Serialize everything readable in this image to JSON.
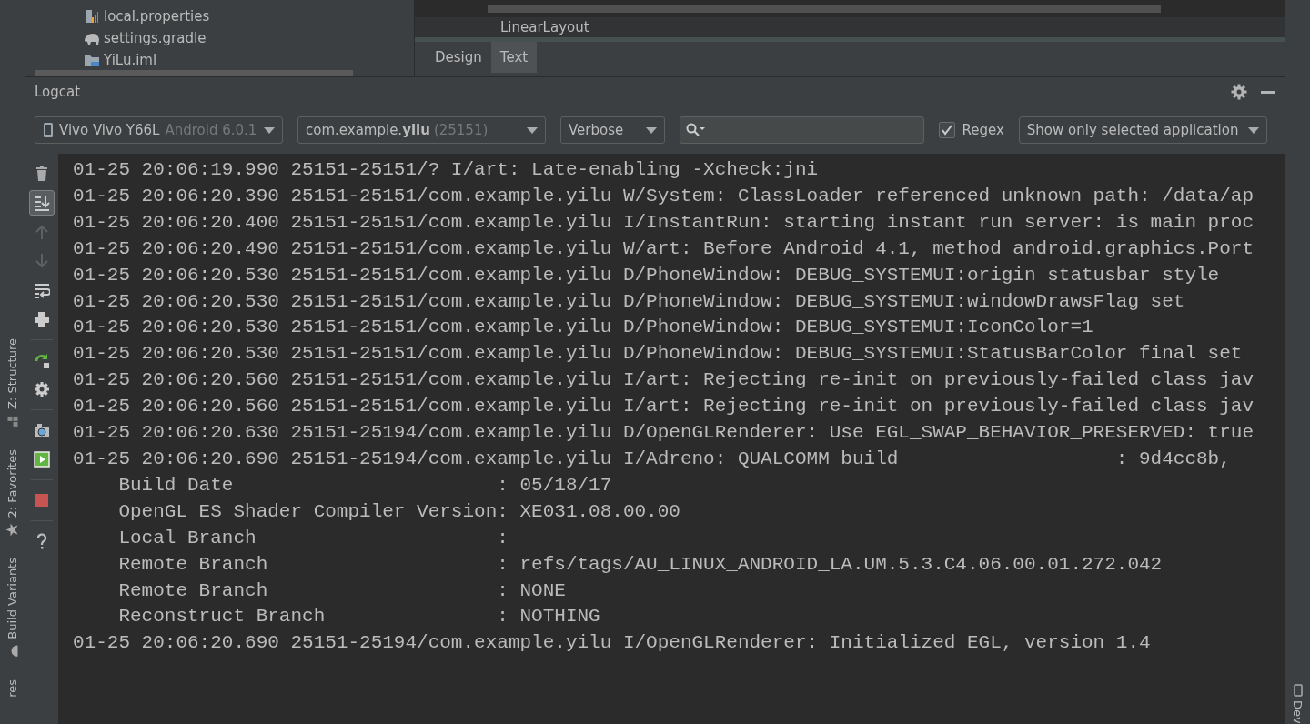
{
  "project_tree": [
    {
      "kind": "properties",
      "label": "local.properties"
    },
    {
      "kind": "gradle",
      "label": "settings.gradle"
    },
    {
      "kind": "module",
      "label": "YiLu.iml"
    }
  ],
  "editor": {
    "breadcrumb": "LinearLayout",
    "tabs": [
      {
        "label": "Design",
        "selected": false
      },
      {
        "label": "Text",
        "selected": true
      }
    ]
  },
  "left_strip": [
    {
      "kind": "structure",
      "label": "Z: Structure"
    },
    {
      "kind": "favorites",
      "label": "2: Favorites"
    },
    {
      "kind": "variants",
      "label": "Build Variants"
    },
    {
      "kind": "captures",
      "label": "res"
    }
  ],
  "right_strip": [
    {
      "kind": "device",
      "label": "Dev"
    }
  ],
  "logcat": {
    "title": "Logcat",
    "device": {
      "name": "Vivo Vivo Y66L",
      "version": "Android 6.0.1"
    },
    "process": {
      "name": "com.example.**yilu**",
      "pid": "(25151)"
    },
    "level": "Verbose",
    "regex": {
      "label": "Regex",
      "checked": true
    },
    "filter": "Show only selected application",
    "tool_groups": [
      [
        {
          "kind": "trash",
          "active": false,
          "disabled": false
        },
        {
          "kind": "scroll-end",
          "active": true,
          "disabled": false
        },
        {
          "kind": "up",
          "active": false,
          "disabled": true
        },
        {
          "kind": "down",
          "active": false,
          "disabled": true
        },
        {
          "kind": "wrap",
          "active": false,
          "disabled": false
        },
        {
          "kind": "print",
          "active": false,
          "disabled": false
        }
      ],
      [
        {
          "kind": "restart",
          "active": false,
          "disabled": false
        },
        {
          "kind": "settings",
          "active": false,
          "disabled": false
        }
      ],
      [
        {
          "kind": "camera",
          "active": false,
          "disabled": false
        },
        {
          "kind": "record",
          "active": false,
          "disabled": false
        }
      ],
      [
        {
          "kind": "stop",
          "active": false,
          "disabled": false
        }
      ],
      [
        {
          "kind": "help",
          "active": false,
          "disabled": false
        }
      ]
    ],
    "lines": [
      "01-25 20:06:19.990 25151-25151/? I/art: Late-enabling -Xcheck:jni",
      "01-25 20:06:20.390 25151-25151/com.example.yilu W/System: ClassLoader referenced unknown path: /data/ap",
      "01-25 20:06:20.400 25151-25151/com.example.yilu I/InstantRun: starting instant run server: is main proc",
      "01-25 20:06:20.490 25151-25151/com.example.yilu W/art: Before Android 4.1, method android.graphics.Port",
      "01-25 20:06:20.530 25151-25151/com.example.yilu D/PhoneWindow: DEBUG_SYSTEMUI:origin statusbar style",
      "01-25 20:06:20.530 25151-25151/com.example.yilu D/PhoneWindow: DEBUG_SYSTEMUI:windowDrawsFlag set",
      "01-25 20:06:20.530 25151-25151/com.example.yilu D/PhoneWindow: DEBUG_SYSTEMUI:IconColor=1",
      "01-25 20:06:20.530 25151-25151/com.example.yilu D/PhoneWindow: DEBUG_SYSTEMUI:StatusBarColor final set",
      "01-25 20:06:20.560 25151-25151/com.example.yilu I/art: Rejecting re-init on previously-failed class jav",
      "01-25 20:06:20.560 25151-25151/com.example.yilu I/art: Rejecting re-init on previously-failed class jav",
      "01-25 20:06:20.630 25151-25194/com.example.yilu D/OpenGLRenderer: Use EGL_SWAP_BEHAVIOR_PRESERVED: true",
      "01-25 20:06:20.690 25151-25194/com.example.yilu I/Adreno: QUALCOMM build                   : 9d4cc8b,",
      "    Build Date                       : 05/18/17",
      "    OpenGL ES Shader Compiler Version: XE031.08.00.00",
      "    Local Branch                     :",
      "    Remote Branch                    : refs/tags/AU_LINUX_ANDROID_LA.UM.5.3.C4.06.00.01.272.042",
      "    Remote Branch                    : NONE",
      "    Reconstruct Branch               : NOTHING",
      "01-25 20:06:20.690 25151-25194/com.example.yilu I/OpenGLRenderer: Initialized EGL, version 1.4"
    ]
  }
}
